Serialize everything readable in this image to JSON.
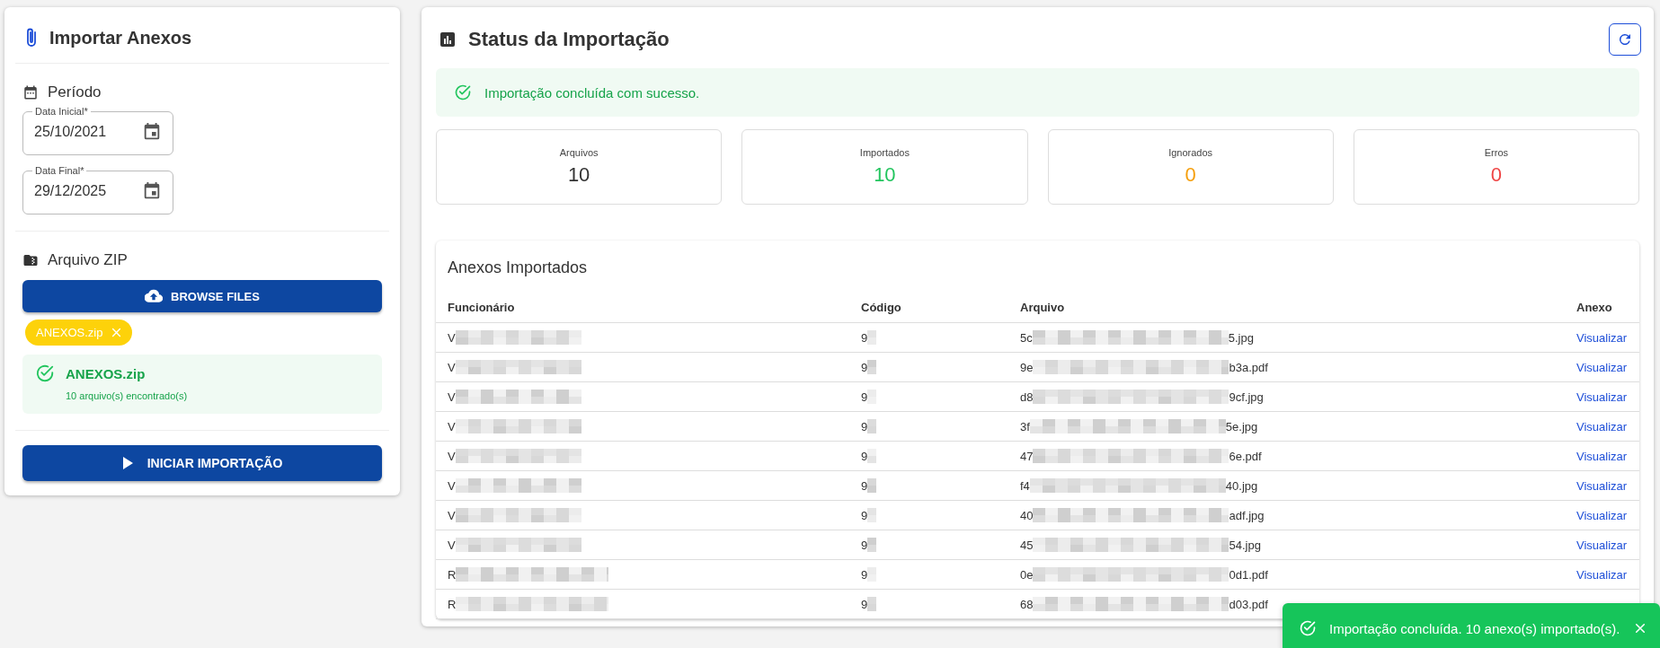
{
  "import_panel": {
    "title": "Importar Anexos",
    "period": {
      "title": "Período",
      "fields": [
        {
          "label": "Data Inicial*",
          "value": "25/10/2021"
        },
        {
          "label": "Data Final*",
          "value": "29/12/2025"
        }
      ]
    },
    "zip": {
      "title": "Arquivo ZIP",
      "browse_button": "BROWSE FILES",
      "chip": "ANEXOS.zip",
      "file": {
        "name": "ANEXOS.zip",
        "detail": "10 arquivo(s) encontrado(s)"
      }
    },
    "start_button": "INICIAR IMPORTAÇÃO"
  },
  "status_panel": {
    "title": "Status da Importação",
    "alert": "Importação concluída com sucesso.",
    "stats": [
      {
        "label": "Arquivos",
        "value": "10",
        "color": "#333333"
      },
      {
        "label": "Importados",
        "value": "10",
        "color": "#22c55e"
      },
      {
        "label": "Ignorados",
        "value": "0",
        "color": "#f59e0b"
      },
      {
        "label": "Erros",
        "value": "0",
        "color": "#ef4444"
      }
    ],
    "table": {
      "title": "Anexos Importados",
      "columns": [
        "Funcionário",
        "Código",
        "Arquivo",
        "Anexo"
      ],
      "rows": [
        {
          "funcionario": "V",
          "codigo": "9",
          "arquivo_start": "5c",
          "arquivo_end": "5.jpg",
          "anexo": "Visualizar"
        },
        {
          "funcionario": "V",
          "codigo": "9",
          "arquivo_start": "9e",
          "arquivo_end": "b3a.pdf",
          "anexo": "Visualizar"
        },
        {
          "funcionario": "V",
          "codigo": "9",
          "arquivo_start": "d8",
          "arquivo_end": "9cf.jpg",
          "anexo": "Visualizar"
        },
        {
          "funcionario": "V",
          "codigo": "9",
          "arquivo_start": "3f",
          "arquivo_end": "5e.jpg",
          "anexo": "Visualizar"
        },
        {
          "funcionario": "V",
          "codigo": "9",
          "arquivo_start": "47",
          "arquivo_end": "6e.pdf",
          "anexo": "Visualizar"
        },
        {
          "funcionario": "V",
          "codigo": "9",
          "arquivo_start": "f4",
          "arquivo_end": "40.jpg",
          "anexo": "Visualizar"
        },
        {
          "funcionario": "V",
          "codigo": "9",
          "arquivo_start": "40",
          "arquivo_end": "adf.jpg",
          "anexo": "Visualizar"
        },
        {
          "funcionario": "V",
          "codigo": "9",
          "arquivo_start": "45",
          "arquivo_end": "54.jpg",
          "anexo": "Visualizar"
        },
        {
          "funcionario": "R",
          "codigo": "9",
          "arquivo_start": "0e",
          "arquivo_end": "0d1.pdf",
          "anexo": "Visualizar"
        },
        {
          "funcionario": "R",
          "codigo": "9",
          "arquivo_start": "68",
          "arquivo_end": "d03.pdf"
        }
      ]
    }
  },
  "toast": {
    "message": "Importação concluída. 10 anexo(s) importado(s)."
  }
}
